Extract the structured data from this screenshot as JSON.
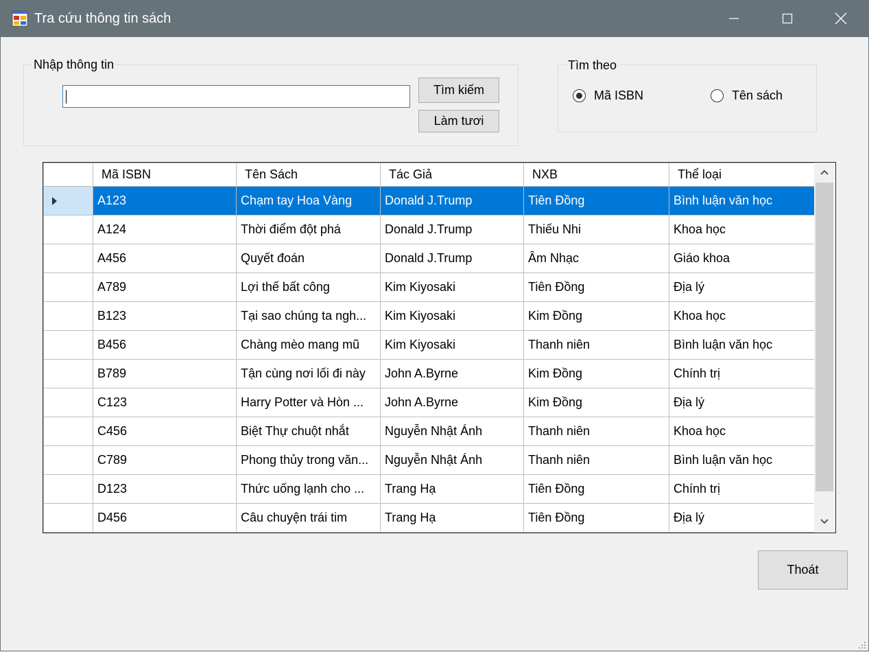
{
  "window": {
    "title": "Tra cứu thông tin sách",
    "controls": [
      "minimize-icon",
      "maximize-icon",
      "close-icon"
    ]
  },
  "input_group": {
    "label": "Nhập thông tin",
    "search_value": "",
    "search_button": "Tìm kiếm",
    "refresh_button": "Làm tươi"
  },
  "search_by": {
    "label": "Tìm theo",
    "options": [
      {
        "label": "Mã ISBN",
        "checked": true
      },
      {
        "label": "Tên sách",
        "checked": false
      }
    ]
  },
  "table": {
    "columns": [
      "Mã ISBN",
      "Tên Sách",
      "Tác Giả",
      "NXB",
      "Thể loại"
    ],
    "selected_row": 0,
    "rows": [
      [
        "A123",
        "Chạm tay Hoa Vàng",
        "Donald J.Trump",
        "Tiên Đồng",
        "Bình luận văn học"
      ],
      [
        "A124",
        "Thời điểm đột phá",
        "Donald J.Trump",
        "Thiếu Nhi",
        "Khoa học"
      ],
      [
        "A456",
        "Quyết đoán",
        "Donald J.Trump",
        "Âm Nhạc",
        "Giáo khoa"
      ],
      [
        "A789",
        "Lợi thế bất công",
        "Kim Kiyosaki",
        "Tiên Đồng",
        "Địa lý"
      ],
      [
        "B123",
        "Tại sao chúng ta ngh...",
        "Kim Kiyosaki",
        "Kim Đồng",
        "Khoa học"
      ],
      [
        "B456",
        "Chàng mèo mang mũ",
        "Kim Kiyosaki",
        "Thanh niên",
        "Bình luận văn học"
      ],
      [
        "B789",
        "Tận cùng nơi lối đi này",
        "John A.Byrne",
        "Kim Đồng",
        "Chính trị"
      ],
      [
        "C123",
        "Harry Potter và Hòn ...",
        "John A.Byrne",
        "Kim Đồng",
        "Địa lý"
      ],
      [
        "C456",
        "Biệt Thự chuột nhắt",
        "Nguyễn Nhật Ánh",
        "Thanh niên",
        "Khoa học"
      ],
      [
        "C789",
        "Phong thủy trong văn...",
        "Nguyễn Nhật Ánh",
        "Thanh niên",
        "Bình luận văn học"
      ],
      [
        "D123",
        "Thức uống lạnh cho ...",
        "Trang Hạ",
        "Tiên Đồng",
        "Chính trị"
      ],
      [
        "D456",
        "Câu chuyện trái tim",
        "Trang Hạ",
        "Tiên Đồng",
        "Địa lý"
      ]
    ]
  },
  "exit_button": "Thoát",
  "colors": {
    "titlebar": "#66747a",
    "selection": "#0078d7",
    "window_bg": "#f0f0f0"
  }
}
